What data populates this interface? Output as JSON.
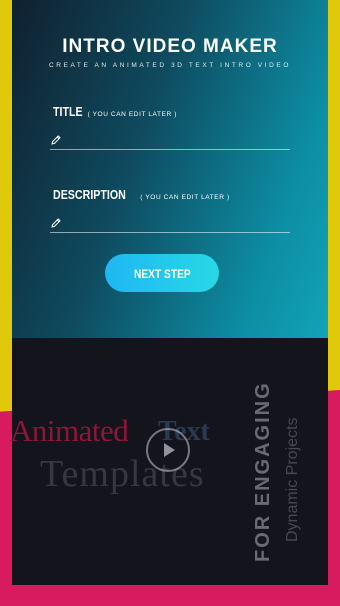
{
  "header": {
    "title": "INTRO VIDEO MAKER",
    "subtitle": "CREATE AN ANIMATED 3D TEXT INTRO VIDEO"
  },
  "form": {
    "title_label": "TITLE",
    "title_hint": "( YOU CAN EDIT LATER )",
    "title_value": "",
    "description_label": "DESCRIPTION",
    "description_hint": "( YOU CAN EDIT LATER )",
    "description_value": "",
    "next_label": "NEXT STEP"
  },
  "preview": {
    "word_animated": "Animated",
    "word_text": "Text",
    "word_templates": "Templates",
    "vertical_main": "FOR ENGAGING",
    "vertical_sub": "Dynamic Projects"
  },
  "icons": {
    "title_field": "pencil-icon",
    "description_field": "pencil-icon",
    "preview": "play-icon"
  },
  "colors": {
    "background": "#e0c80a",
    "accent_pink": "#d81b5e",
    "button": "#1fb7f2",
    "gradient_end": "#13a3b8"
  }
}
